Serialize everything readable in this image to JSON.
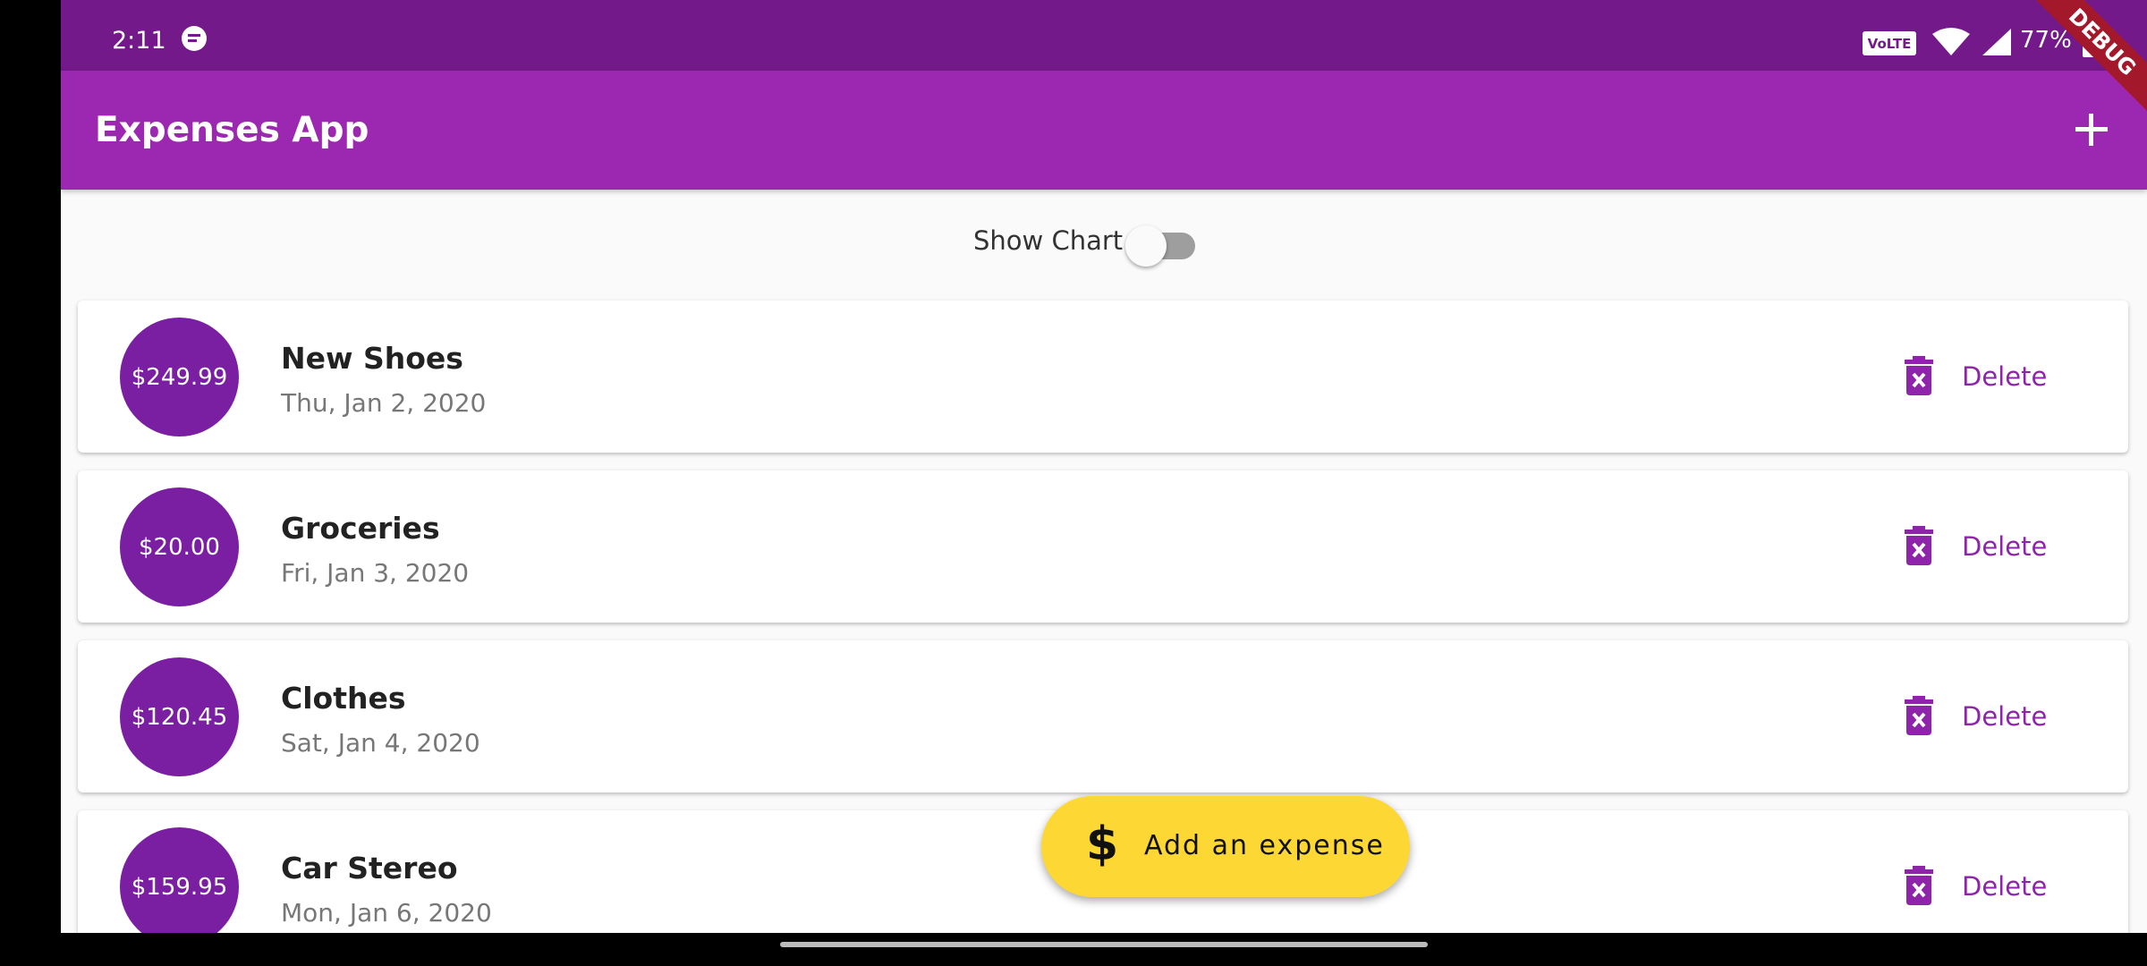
{
  "status_bar": {
    "time": "2:11",
    "network_badge": "VoLTE",
    "battery_percent": "77%"
  },
  "debug_banner": "DEBUG",
  "app_bar": {
    "title": "Expenses App",
    "add_icon": "plus-icon"
  },
  "chart_toggle": {
    "label": "Show Chart",
    "on": false
  },
  "expenses": [
    {
      "amount": "$249.99",
      "title": "New Shoes",
      "date": "Thu, Jan 2, 2020",
      "delete_label": "Delete"
    },
    {
      "amount": "$20.00",
      "title": "Groceries",
      "date": "Fri, Jan 3, 2020",
      "delete_label": "Delete"
    },
    {
      "amount": "$120.45",
      "title": "Clothes",
      "date": "Sat, Jan 4, 2020",
      "delete_label": "Delete"
    },
    {
      "amount": "$159.95",
      "title": "Car Stereo",
      "date": "Mon, Jan 6, 2020",
      "delete_label": "Delete"
    }
  ],
  "fab": {
    "icon": "$",
    "label": "Add an expense"
  },
  "colors": {
    "status_bar": "#74198a",
    "app_bar": "#9c27b0",
    "amount_circle": "#7b1fa2",
    "delete": "#8e24aa",
    "fab": "#fdd835"
  }
}
